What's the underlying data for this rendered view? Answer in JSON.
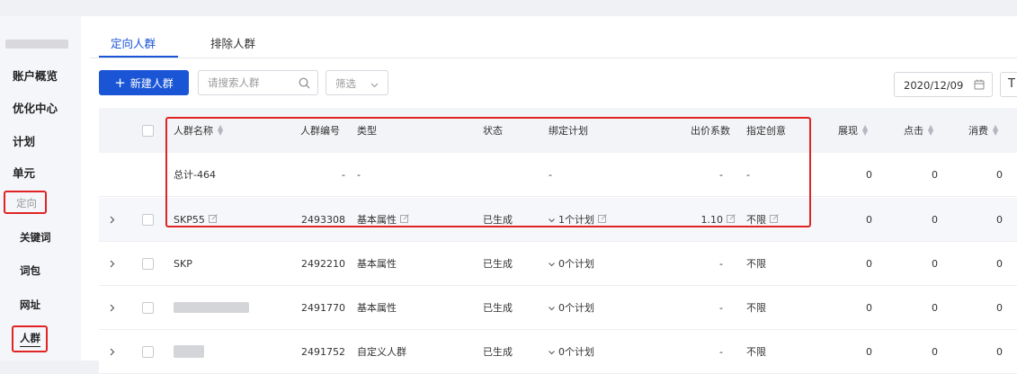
{
  "sidebar": {
    "items": [
      "账户概览",
      "优化中心",
      "计划",
      "单元",
      "定向"
    ],
    "sub_items": [
      "关键词",
      "词包",
      "网址",
      "人群"
    ]
  },
  "tabs": [
    "定向人群",
    "排除人群"
  ],
  "toolbar": {
    "new_button": "新建人群",
    "search_placeholder": "请搜索人群",
    "filter_label": "筛选",
    "date": "2020/12/09",
    "extra_label": "T"
  },
  "columns": {
    "name": "人群名称",
    "id": "人群编号",
    "type": "类型",
    "status": "状态",
    "plan": "绑定计划",
    "bid": "出价系数",
    "creative": "指定创意",
    "impressions": "展现",
    "clicks": "点击",
    "cost": "消费"
  },
  "colors": {
    "accent": "#1a55d6",
    "highlight_border": "#e02424"
  },
  "total_row": {
    "name": "总计-464",
    "id": "-",
    "type": "-",
    "plan": "-",
    "bid": "-",
    "creative": "-",
    "impressions": "0",
    "clicks": "0",
    "cost": "0"
  },
  "rows": [
    {
      "name": "SKP55",
      "id": "2493308",
      "type": "基本属性",
      "status": "已生成",
      "plan": "1个计划",
      "bid": "1.10",
      "creative": "不限",
      "impressions": "0",
      "clicks": "0",
      "cost": "0"
    },
    {
      "name": "SKP",
      "id": "2492210",
      "type": "基本属性",
      "status": "已生成",
      "plan": "0个计划",
      "bid": "-",
      "creative": "不限",
      "impressions": "0",
      "clicks": "0",
      "cost": "0"
    },
    {
      "name": "",
      "id": "2491770",
      "type": "基本属性",
      "status": "已生成",
      "plan": "0个计划",
      "bid": "-",
      "creative": "不限",
      "impressions": "0",
      "clicks": "0",
      "cost": "0"
    },
    {
      "name": "",
      "id": "2491752",
      "type": "自定义人群",
      "status": "已生成",
      "plan": "0个计划",
      "bid": "-",
      "creative": "不限",
      "impressions": "0",
      "clicks": "0",
      "cost": "0"
    }
  ]
}
